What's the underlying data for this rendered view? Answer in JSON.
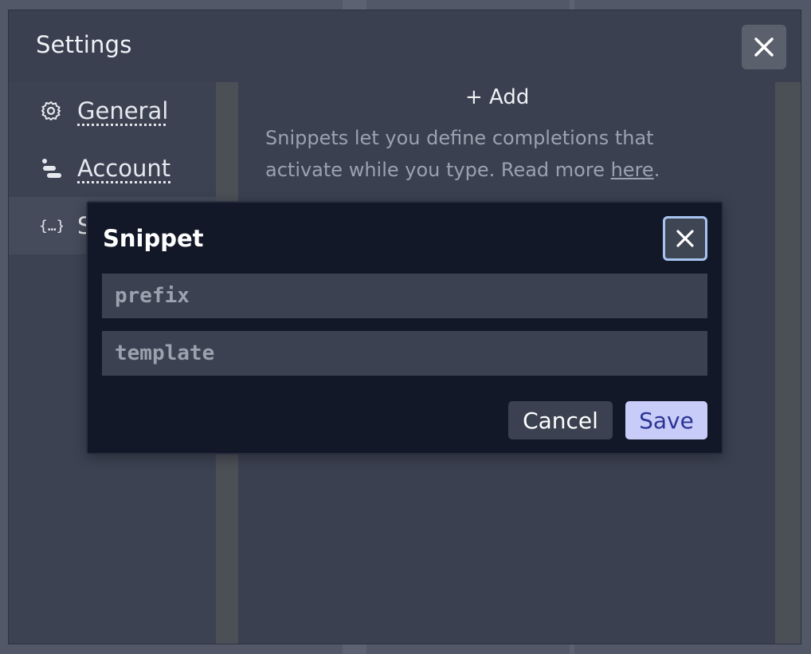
{
  "settings": {
    "title": "Settings",
    "nav": [
      {
        "label": "General",
        "icon": "gear-icon"
      },
      {
        "label": "Account",
        "icon": "account-icon"
      },
      {
        "label": "S",
        "icon": "snippets-icon"
      }
    ]
  },
  "snippets_panel": {
    "add_label": "+ Add",
    "description": "Snippets let you define completions that activate while you type. Read more ",
    "link_text": "here",
    "period": "."
  },
  "modal": {
    "title": "Snippet",
    "prefix_placeholder": "prefix",
    "template_placeholder": "template",
    "cancel_label": "Cancel",
    "save_label": "Save"
  },
  "colors": {
    "modal_bg": "#131828",
    "save_bg": "#c8ccf8",
    "save_text": "#2c3494",
    "focus_ring": "#a8c4f0"
  }
}
